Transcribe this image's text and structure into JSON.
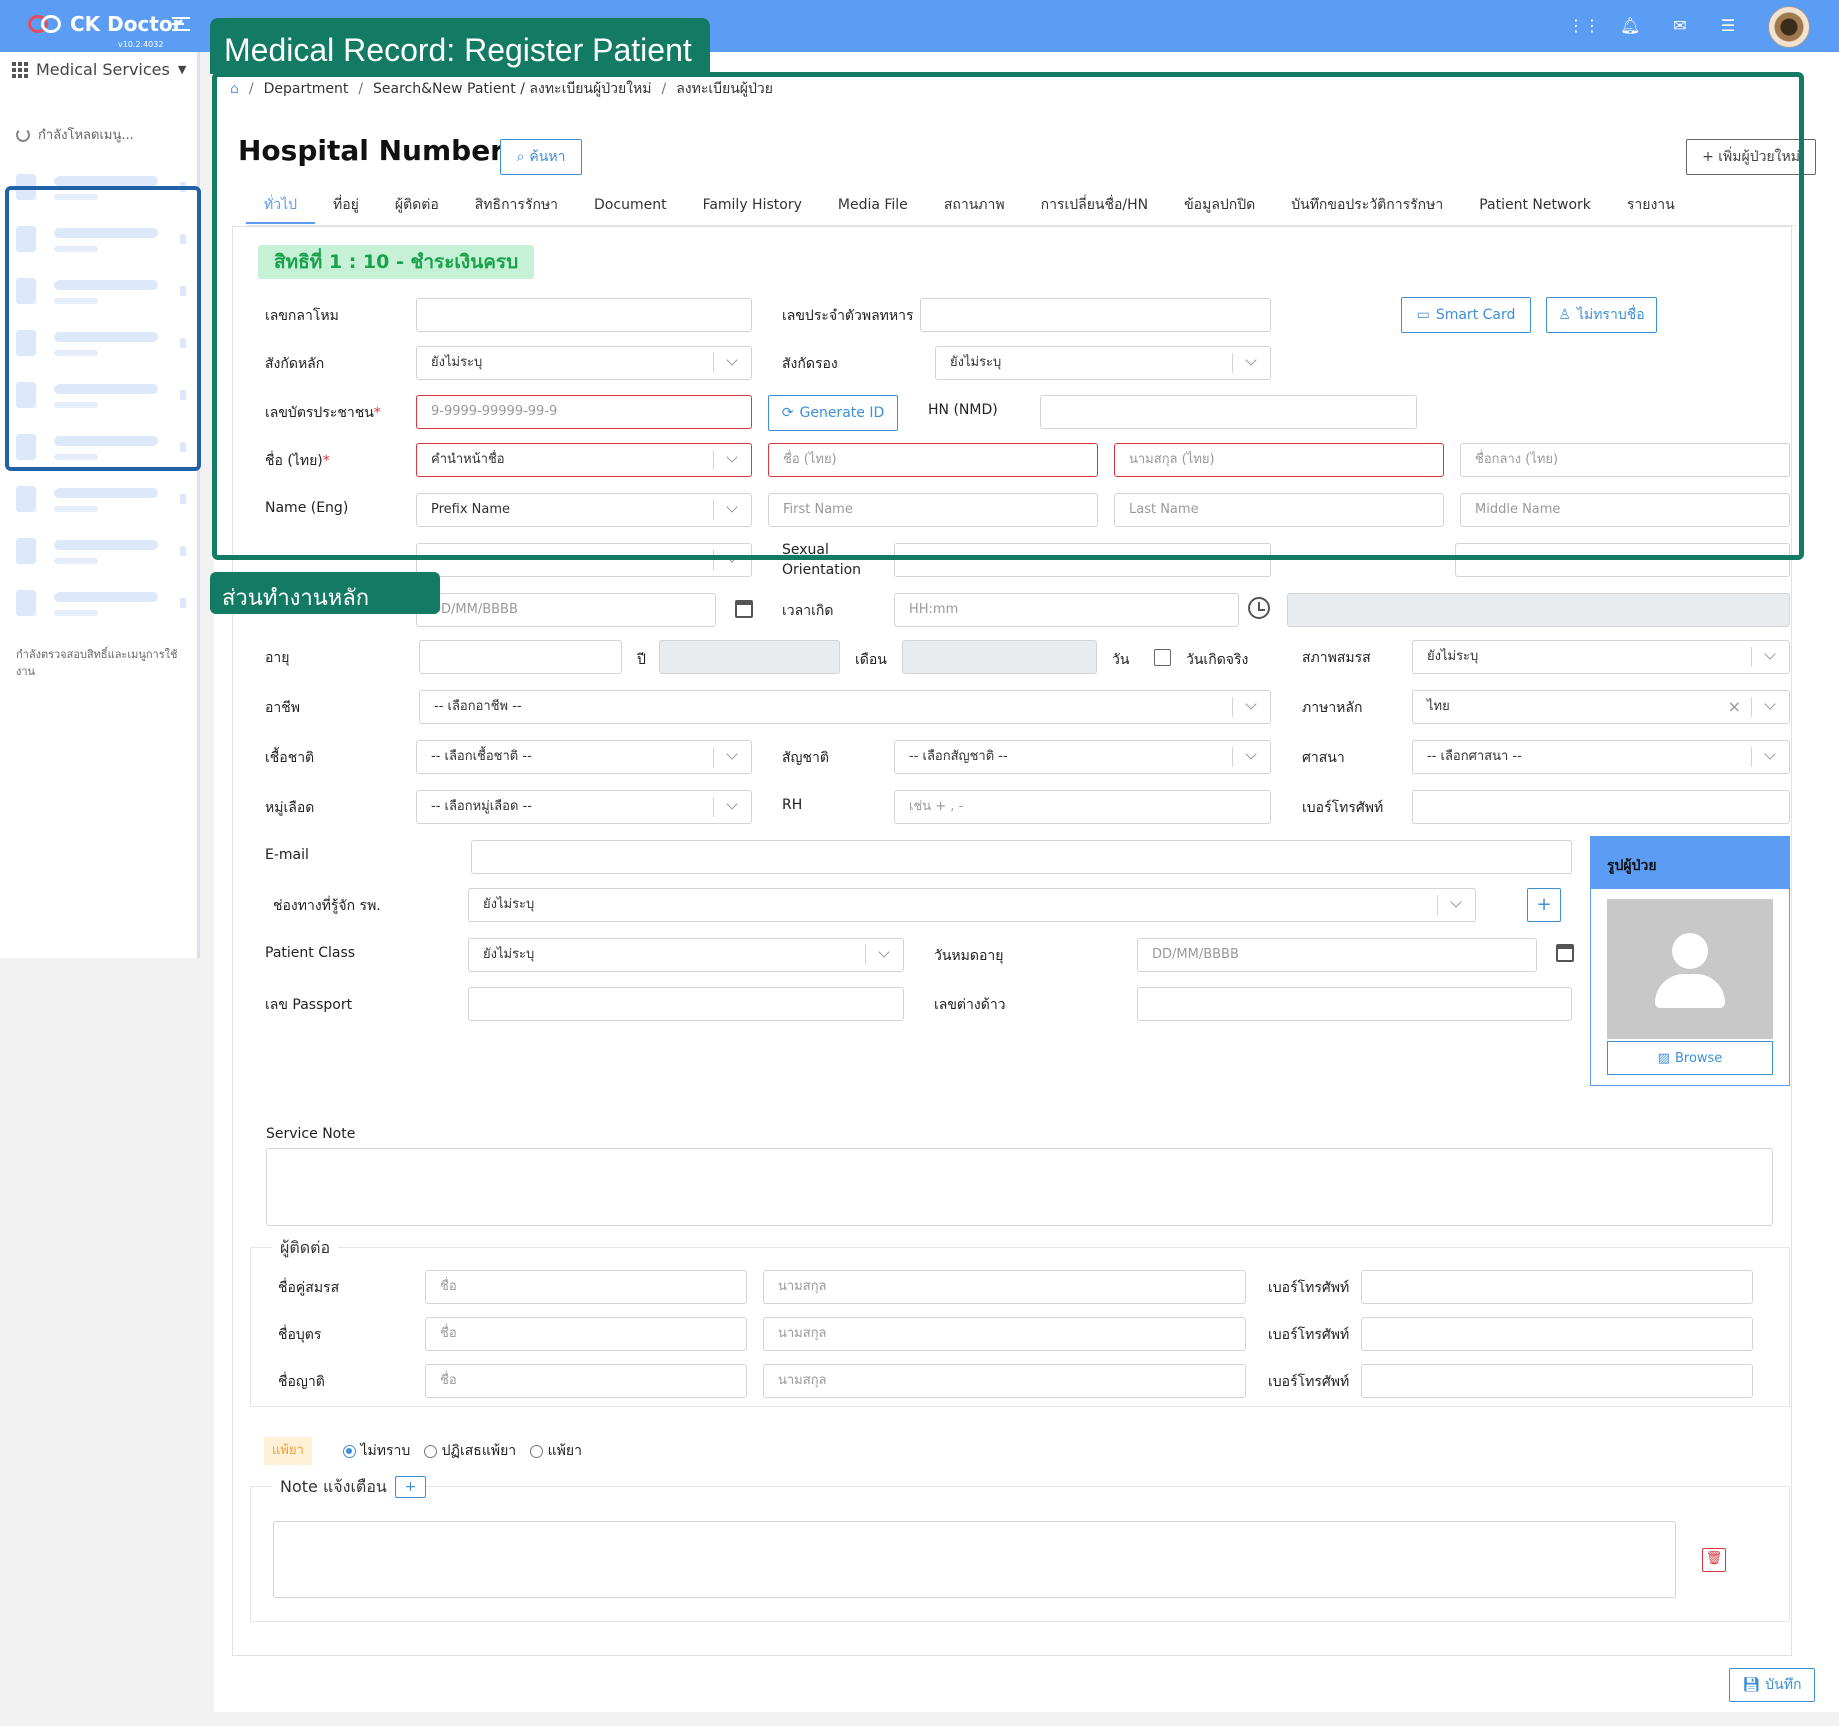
{
  "app": {
    "name": "CK Doctor",
    "version": "v10.2.4032"
  },
  "sidebar": {
    "title": "Medical Services",
    "loading": "กำลังโหลดเมนู...",
    "note": "กำลังตรวจสอบสิทธิ์และเมนูการใช้งาน"
  },
  "breadcrumb": [
    "Department",
    "Search&New Patient / ลงทะเบียนผู้ป่วยใหม่",
    "ลงทะเบียนผู้ป่วย"
  ],
  "header": {
    "title": "Hospital Number",
    "search_label": "ค้นหา",
    "add_label": "+ เพิ่มผู้ป่วยใหม่"
  },
  "tabs": [
    "ทั่วไป",
    "ที่อยู่",
    "ผู้ติดต่อ",
    "สิทธิการรักษา",
    "Document",
    "Family History",
    "Media File",
    "สถานภาพ",
    "การเปลี่ยนชื่อ/HN",
    "ข้อมูลปกปิด",
    "บันทึกขอประวัติการรักษา",
    "Patient Network",
    "รายงาน"
  ],
  "right_badge": "สิทธิที่ 1 : 10 - ชำระเงินครบ",
  "form": {
    "old_number_label": "เลขกลาโหม",
    "military_id_label": "เลขประจำตัวพลทหาร",
    "smart_card_label": "Smart Card",
    "unknown_name_label": "ไม่ทราบชื่อ",
    "main_unit_label": "สังกัดหลัก",
    "main_unit_value": "ยังไม่ระบุ",
    "sub_unit_label": "สังกัดรอง",
    "sub_unit_value": "ยังไม่ระบุ",
    "citizen_id_label": "เลขบัตรประชาชน",
    "citizen_id_placeholder": "9-9999-99999-99-9",
    "generate_label": "Generate ID",
    "hn_nmd_label": "HN (NMD)",
    "name_th_label": "ชื่อ (ไทย)",
    "prefix_th_value": "คำนำหน้าชื่อ",
    "first_th_placeholder": "ชื่อ (ไทย)",
    "last_th_placeholder": "นามสกุล (ไทย)",
    "middle_th_placeholder": "ชื่อกลาง (ไทย)",
    "name_en_label": "Name (Eng)",
    "prefix_en_value": "Prefix Name",
    "first_en_placeholder": "First Name",
    "last_en_placeholder": "Last Name",
    "middle_en_placeholder": "Middle Name",
    "sexual_orientation_label": "Sexual Orientation",
    "birth_date_placeholder": "DD/MM/BBBB",
    "birth_time_label": "เวลาเกิด",
    "birth_time_placeholder": "HH:mm",
    "age_label": "อายุ",
    "year_label": "ปี",
    "month_label": "เดือน",
    "day_label": "วัน",
    "real_birthday_label": "วันเกิดจริง",
    "marital_label": "สภาพสมรส",
    "marital_value": "ยังไม่ระบุ",
    "occupation_label": "อาชีพ",
    "occupation_value": "-- เลือกอาชีพ --",
    "language_label": "ภาษาหลัก",
    "language_value": "ไทย",
    "race_label": "เชื้อชาติ",
    "race_value": "-- เลือกเชื้อชาติ --",
    "nationality_label": "สัญชาติ",
    "nationality_value": "-- เลือกสัญชาติ --",
    "religion_label": "ศาสนา",
    "religion_value": "-- เลือกศาสนา --",
    "blood_label": "หมู่เลือด",
    "blood_value": "-- เลือกหมู่เลือด --",
    "rh_label": "RH",
    "rh_placeholder": "เช่น + , -",
    "phone_label": "เบอร์โทรศัพท์",
    "email_label": "E-mail",
    "channel_label": "ช่องทางที่รู้จัก รพ.",
    "channel_value": "ยังไม่ระบุ",
    "patient_class_label": "Patient Class",
    "patient_class_value": "ยังไม่ระบุ",
    "expiry_label": "วันหมดอายุ",
    "expiry_placeholder": "DD/MM/BBBB",
    "passport_label": "เลข Passport",
    "alien_label": "เลขต่างด้าว",
    "service_note_label": "Service Note"
  },
  "photo": {
    "title": "รูปผู้ป่วย",
    "browse_label": "Browse"
  },
  "contacts": {
    "legend": "ผู้ติดต่อ",
    "rows": [
      {
        "label": "ชื่อคู่สมรส",
        "first": "ชื่อ",
        "last": "นามสกุล",
        "phone": "เบอร์โทรศัพท์"
      },
      {
        "label": "ชื่อบุตร",
        "first": "ชื่อ",
        "last": "นามสกุล",
        "phone": "เบอร์โทรศัพท์"
      },
      {
        "label": "ชื่อญาติ",
        "first": "ชื่อ",
        "last": "นามสกุล",
        "phone": "เบอร์โทรศัพท์"
      }
    ]
  },
  "allergy": {
    "badge": "แพ้ยา",
    "options": [
      "ไม่ทราบ",
      "ปฏิเสธแพ้ยา",
      "แพ้ยา"
    ],
    "selected": "ไม่ทราบ"
  },
  "note_alert": {
    "legend": "Note แจ้งเตือน"
  },
  "save_label": "บันทึก",
  "annotations": {
    "title": "Medical Record: Register Patient",
    "section": "ส่วนทำงานหลัก"
  },
  "colors": {
    "topbar": "#5b9cf5",
    "accent": "#3d8fd6",
    "annotation": "#137a64",
    "badge_bg": "#c6f1d7",
    "badge_fg": "#18a34a"
  }
}
